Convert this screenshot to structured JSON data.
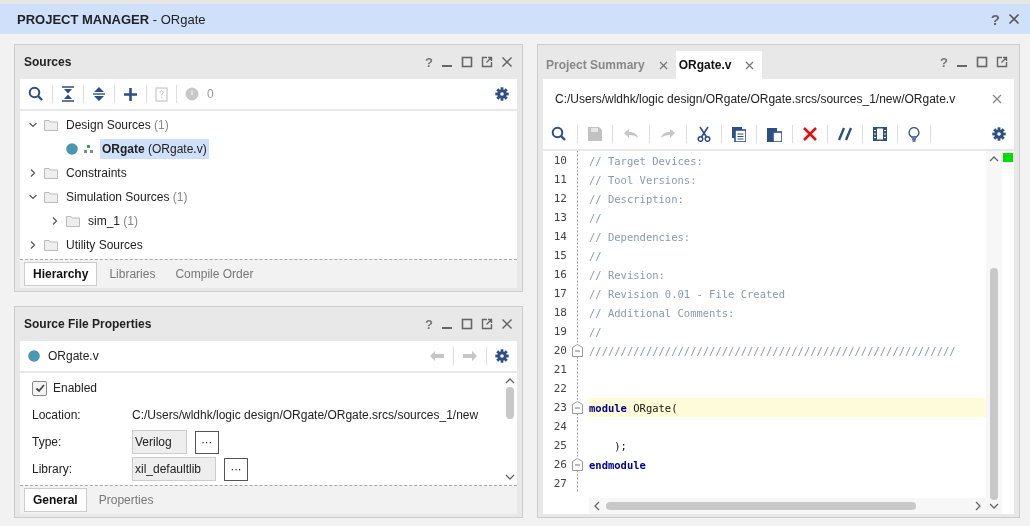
{
  "window": {
    "title": "**PROJECT MANAGER** - ORgate",
    "help": "?"
  },
  "sources": {
    "title": "Sources",
    "help": "?",
    "badge_count": "0",
    "tree": [
      {
        "kind": "folder",
        "label": "Design Sources",
        "count": "(1)",
        "expanded": true,
        "selected": false,
        "children": [
          {
            "kind": "module",
            "label": "ORgate",
            "file": "(ORgate.v)",
            "selected": true
          }
        ]
      },
      {
        "kind": "folder",
        "label": "Constraints",
        "expanded": false,
        "selected": false
      },
      {
        "kind": "folder",
        "label": "Simulation Sources",
        "count": "(1)",
        "expanded": true,
        "selected": false,
        "children": [
          {
            "kind": "folder",
            "label": "sim_1",
            "count": "(1)",
            "expanded": false,
            "selected": false
          }
        ]
      },
      {
        "kind": "folder",
        "label": "Utility Sources",
        "expanded": false,
        "selected": false
      }
    ],
    "tabs": [
      {
        "label": "Hierarchy",
        "selected": true
      },
      {
        "label": "Libraries",
        "selected": false
      },
      {
        "label": "Compile Order",
        "selected": false
      }
    ]
  },
  "properties": {
    "title": "Source File Properties",
    "help": "?",
    "file": "ORgate.v",
    "enabled": {
      "label": "Enabled",
      "checked": true
    },
    "fields": [
      {
        "label": "Location:",
        "value": "C:/Users/wldhk/logic design/ORgate/ORgate.srcs/sources_1/new",
        "kind": "text"
      },
      {
        "label": "Type:",
        "value": "Verilog",
        "kind": "choice",
        "more": "···"
      },
      {
        "label": "Library:",
        "value": "xil_defaultlib",
        "kind": "choice",
        "more": "···"
      }
    ],
    "tabs": [
      {
        "label": "General",
        "selected": true
      },
      {
        "label": "Properties",
        "selected": false
      }
    ]
  },
  "editor": {
    "help": "?",
    "tabs": [
      {
        "label": "Project Summary",
        "selected": false
      },
      {
        "label": "ORgate.v",
        "selected": true
      }
    ],
    "path": "C:/Users/wldhk/logic design/ORgate/ORgate.srcs/sources_1/new/ORgate.v",
    "lines": [
      {
        "number": "10",
        "fold": false,
        "highlighted": false,
        "tokens": [
          {
            "kind": "comment",
            "text": "// Target Devices:"
          }
        ]
      },
      {
        "number": "11",
        "fold": false,
        "highlighted": false,
        "tokens": [
          {
            "kind": "comment",
            "text": "// Tool Versions:"
          }
        ]
      },
      {
        "number": "12",
        "fold": false,
        "highlighted": false,
        "tokens": [
          {
            "kind": "comment",
            "text": "// Description:"
          }
        ]
      },
      {
        "number": "13",
        "fold": false,
        "highlighted": false,
        "tokens": [
          {
            "kind": "comment",
            "text": "//"
          }
        ]
      },
      {
        "number": "14",
        "fold": false,
        "highlighted": false,
        "tokens": [
          {
            "kind": "comment",
            "text": "// Dependencies:"
          }
        ]
      },
      {
        "number": "15",
        "fold": false,
        "highlighted": false,
        "tokens": [
          {
            "kind": "comment",
            "text": "//"
          }
        ]
      },
      {
        "number": "16",
        "fold": false,
        "highlighted": false,
        "tokens": [
          {
            "kind": "comment",
            "text": "// Revision:"
          }
        ]
      },
      {
        "number": "17",
        "fold": false,
        "highlighted": false,
        "tokens": [
          {
            "kind": "comment",
            "text": "// Revision 0.01 - File Created"
          }
        ]
      },
      {
        "number": "18",
        "fold": false,
        "highlighted": false,
        "tokens": [
          {
            "kind": "comment",
            "text": "// Additional Comments:"
          }
        ]
      },
      {
        "number": "19",
        "fold": false,
        "highlighted": false,
        "tokens": [
          {
            "kind": "comment",
            "text": "//"
          }
        ]
      },
      {
        "number": "20",
        "fold": true,
        "highlighted": false,
        "tokens": [
          {
            "kind": "comment",
            "text": "//////////////////////////////////////////////////////////"
          }
        ]
      },
      {
        "number": "21",
        "fold": false,
        "highlighted": false
      },
      {
        "number": "22",
        "fold": false,
        "highlighted": false
      },
      {
        "number": "23",
        "fold": true,
        "highlighted": true,
        "tokens": [
          {
            "kind": "keyword",
            "text": "module"
          },
          {
            "kind": "plain",
            "text": " ORgate("
          }
        ]
      },
      {
        "number": "24",
        "fold": false,
        "highlighted": false
      },
      {
        "number": "25",
        "fold": false,
        "highlighted": false,
        "tokens": [
          {
            "kind": "plain",
            "text": "    );"
          }
        ]
      },
      {
        "number": "26",
        "fold": true,
        "highlighted": false,
        "tokens": [
          {
            "kind": "keyword",
            "text": "endmodule"
          }
        ]
      },
      {
        "number": "27",
        "fold": false,
        "highlighted": false
      }
    ]
  }
}
